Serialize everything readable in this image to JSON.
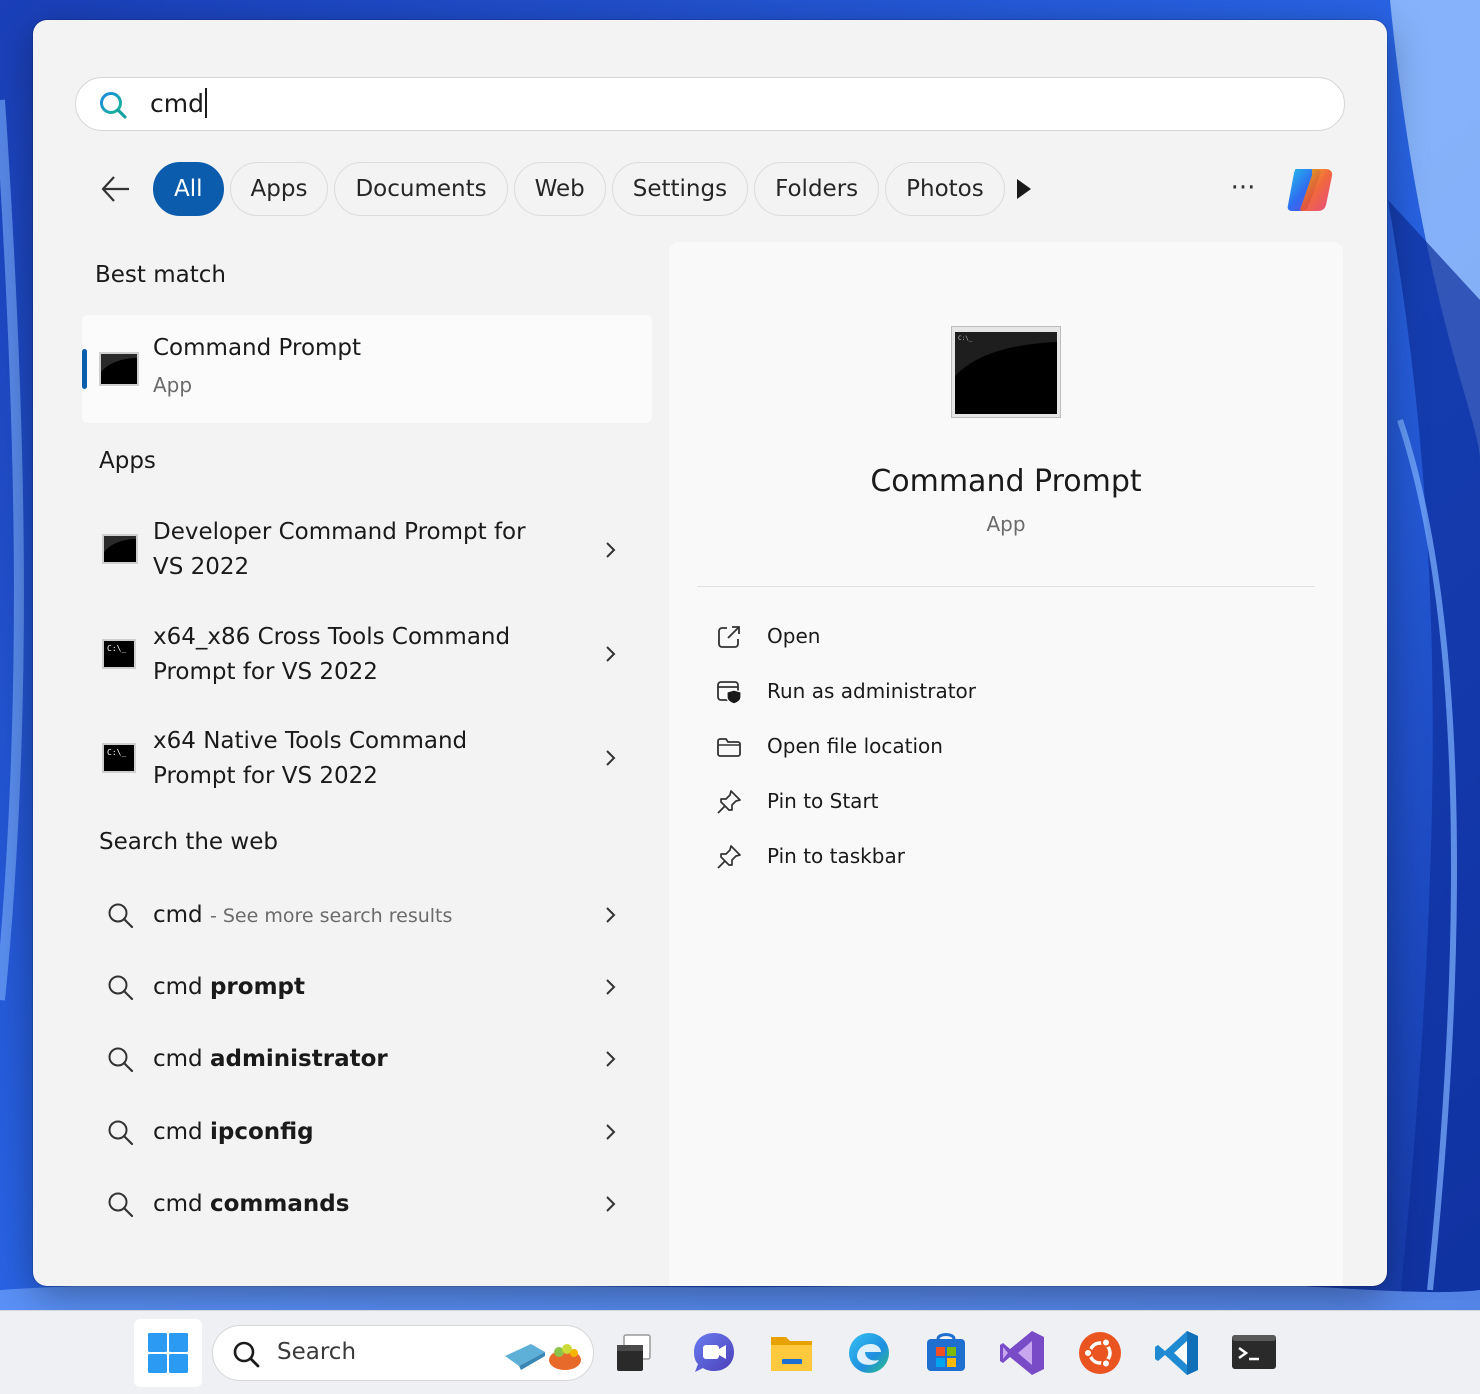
{
  "search": {
    "query": "cmd"
  },
  "filters": [
    "All",
    "Apps",
    "Documents",
    "Web",
    "Settings",
    "Folders",
    "Photos"
  ],
  "active_filter": "All",
  "best_match": {
    "heading": "Best match",
    "title": "Command Prompt",
    "subtitle": "App"
  },
  "apps": {
    "heading": "Apps",
    "items": [
      {
        "line1": "Developer Command Prompt for",
        "line2": "VS 2022"
      },
      {
        "line1": "x64_x86 Cross Tools Command",
        "line2": "Prompt for VS 2022"
      },
      {
        "line1": "x64 Native Tools Command",
        "line2": "Prompt for VS 2022"
      }
    ]
  },
  "web": {
    "heading": "Search the web",
    "first": {
      "prefix": "cmd",
      "suffix": "- See more search results"
    },
    "items": [
      {
        "prefix": "cmd",
        "bold": "prompt"
      },
      {
        "prefix": "cmd",
        "bold": "administrator"
      },
      {
        "prefix": "cmd",
        "bold": "ipconfig"
      },
      {
        "prefix": "cmd",
        "bold": "commands"
      }
    ]
  },
  "detail": {
    "title": "Command Prompt",
    "subtitle": "App",
    "actions": [
      {
        "label": "Open",
        "icon": "open-external-icon"
      },
      {
        "label": "Run as administrator",
        "icon": "shield-window-icon"
      },
      {
        "label": "Open file location",
        "icon": "folder-icon"
      },
      {
        "label": "Pin to Start",
        "icon": "pin-icon"
      },
      {
        "label": "Pin to taskbar",
        "icon": "pin-icon"
      }
    ]
  },
  "taskbar": {
    "search_label": "Search",
    "apps": [
      "task-view",
      "teams",
      "file-explorer",
      "edge",
      "microsoft-store",
      "visual-studio",
      "ubuntu",
      "vscode",
      "terminal"
    ]
  },
  "colors": {
    "accent": "#0b5cad",
    "panel": "#f3f3f3",
    "detail": "#f9f9f9"
  }
}
